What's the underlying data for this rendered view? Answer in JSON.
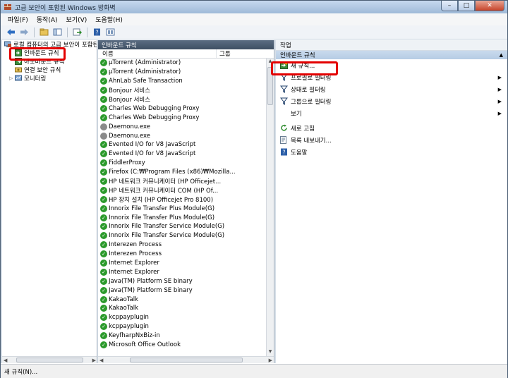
{
  "window": {
    "title": "고급 보안이 포함된 Windows 방화벽",
    "minimize": "–",
    "maximize": "□",
    "close": "✕"
  },
  "menu": [
    "파일(F)",
    "동작(A)",
    "보기(V)",
    "도움말(H)"
  ],
  "toolbar": {
    "icons": [
      "back-icon",
      "forward-icon",
      "folder-icon",
      "console-tree-icon",
      "export-icon",
      "help-icon",
      "properties-icon"
    ]
  },
  "tree": {
    "root": "로컬 컴퓨터의 고급 보안이 포함된",
    "items": [
      "인바운드 규칙",
      "아웃바운드 규칙",
      "연결 보안 규칙",
      "모니터링"
    ]
  },
  "middle": {
    "header": "인바운드 규칙",
    "col_name": "이름",
    "col_group": "그룹",
    "rules": [
      "µTorrent (Administrator)",
      "µTorrent (Administrator)",
      "AhnLab Safe Transaction",
      "Bonjour 서비스",
      "Bonjour 서비스",
      "Charles Web Debugging Proxy",
      "Charles Web Debugging Proxy",
      "Daemonu.exe",
      "Daemonu.exe",
      "Evented I/O for V8 JavaScript",
      "Evented I/O for V8 JavaScript",
      "FiddlerProxy",
      "Firefox (C:₩Program Files (x86)₩Mozilla...",
      "HP 네트워크 커뮤니케이터 (HP Officejet...",
      "HP 네트워크 커뮤니케이터 COM (HP Of...",
      "HP 장치 설치 (HP Officejet Pro 8100)",
      "Innorix File Transfer Plus Module(G)",
      "Innorix File Transfer Plus Module(G)",
      "Innorix File Transfer Service Module(G)",
      "Innorix File Transfer Service Module(G)",
      "Interezen Process",
      "Interezen Process",
      "Internet Explorer",
      "Internet Explorer",
      "Java(TM) Platform SE binary",
      "Java(TM) Platform SE binary",
      "KakaoTalk",
      "KakaoTalk",
      "kcppayplugin",
      "kcppayplugin",
      "KeyfharpNxBiz-in",
      "Microsoft Office Outlook"
    ],
    "disabled_indices": [
      7,
      8
    ]
  },
  "actions": {
    "header": "작업",
    "section": "인바운드 규칙",
    "items": [
      {
        "label": "새 규칙...",
        "icon": "new-rule-icon",
        "submenu": false
      },
      {
        "label": "프로필로 필터링",
        "icon": "filter-icon",
        "submenu": true
      },
      {
        "label": "상태로 필터링",
        "icon": "filter-icon",
        "submenu": true
      },
      {
        "label": "그룹으로 필터링",
        "icon": "filter-icon",
        "submenu": true
      },
      {
        "label": "보기",
        "icon": "",
        "submenu": true
      },
      {
        "label": "새로 고침",
        "icon": "refresh-icon",
        "submenu": false
      },
      {
        "label": "목록 내보내기...",
        "icon": "export-list-icon",
        "submenu": false
      },
      {
        "label": "도움말",
        "icon": "help-icon",
        "submenu": false
      }
    ]
  },
  "status": "새 규칙(N)..."
}
